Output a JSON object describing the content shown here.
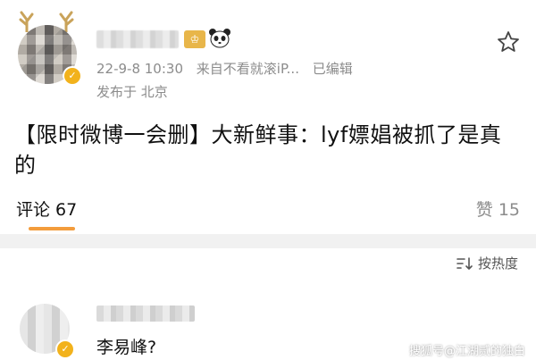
{
  "post": {
    "timestamp": "22-9-8 10:30",
    "source": "来自不看就滚iP...",
    "edited": "已编辑",
    "location": "发布于 北京",
    "text": "【限时微博一会删】大新鲜事：lyf嫖娼被抓了是真的"
  },
  "tabs": {
    "comments_label": "评论",
    "comments_count": "67",
    "likes_label": "赞",
    "likes_count": "15"
  },
  "comments": {
    "sort_label": "按热度",
    "first_comment_text": "李易峰?"
  },
  "watermark": "搜狐号@江湖贰的独白",
  "icons": {
    "favorite": "star-icon",
    "sort": "sort-icon",
    "verified": "verified-badge-icon"
  },
  "colors": {
    "accent": "#f39c3c",
    "muted_text": "#8c8c8c",
    "badge": "#f2b21c"
  }
}
